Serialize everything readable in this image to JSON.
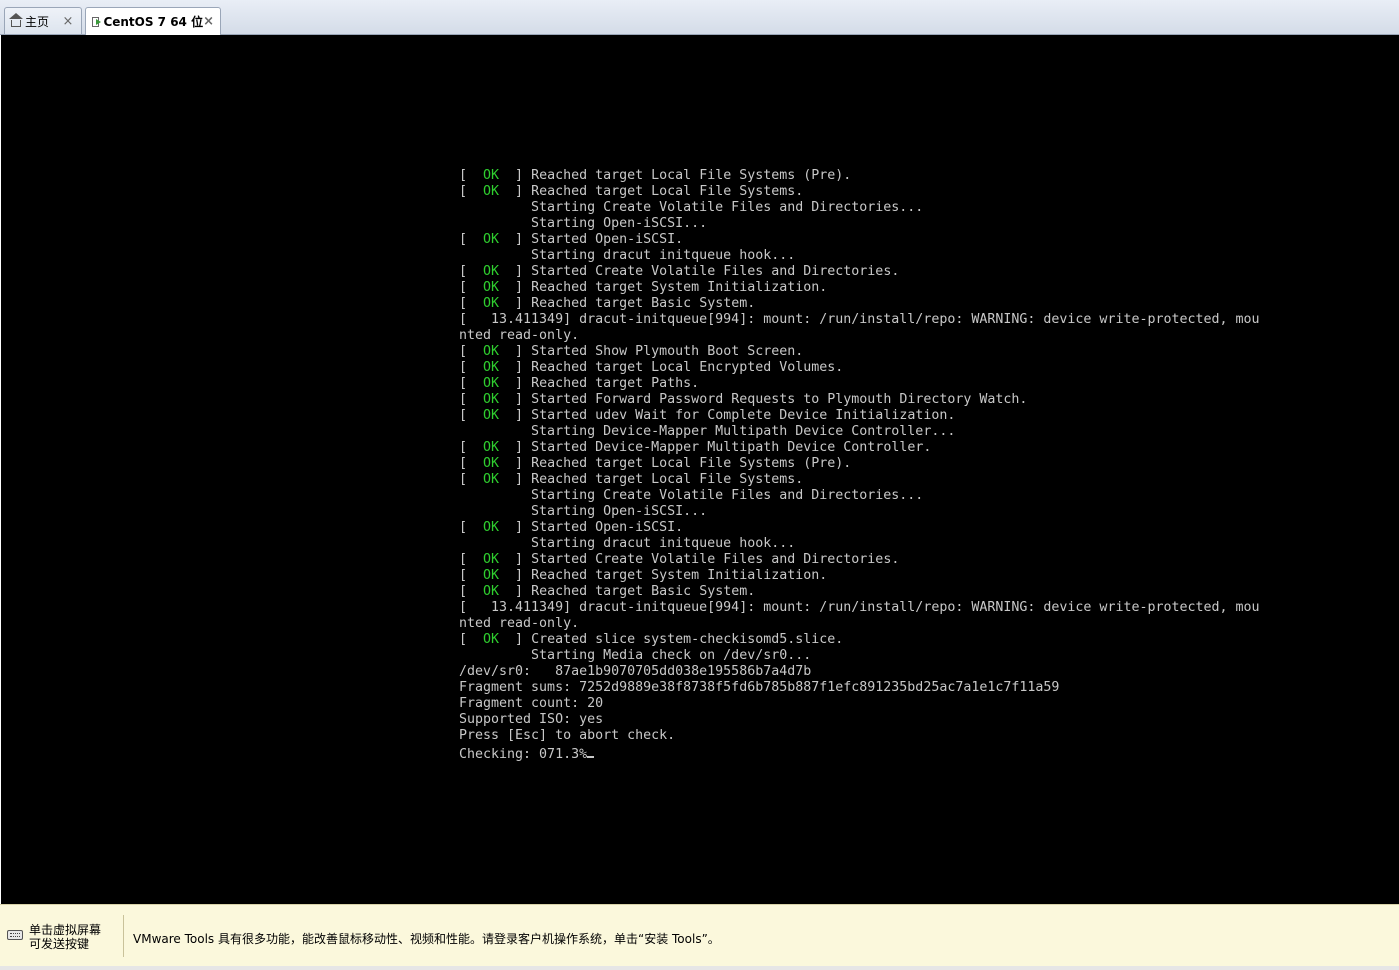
{
  "tabs": [
    {
      "label": "主页",
      "icon": "home-icon",
      "close": "×"
    },
    {
      "label": "CentOS 7 64 位",
      "icon": "vm-icon",
      "close": "×"
    }
  ],
  "console_lines": [
    {
      "ok": true,
      "text": "Reached target Local File Systems (Pre)."
    },
    {
      "ok": true,
      "text": "Reached target Local File Systems."
    },
    {
      "ok": false,
      "text": "         Starting Create Volatile Files and Directories..."
    },
    {
      "ok": false,
      "text": "         Starting Open-iSCSI..."
    },
    {
      "ok": true,
      "text": "Started Open-iSCSI."
    },
    {
      "ok": false,
      "text": "         Starting dracut initqueue hook..."
    },
    {
      "ok": true,
      "text": "Started Create Volatile Files and Directories."
    },
    {
      "ok": true,
      "text": "Reached target System Initialization."
    },
    {
      "ok": true,
      "text": "Reached target Basic System."
    },
    {
      "ok": false,
      "text": "[   13.411349] dracut-initqueue[994]: mount: /run/install/repo: WARNING: device write-protected, mou"
    },
    {
      "ok": false,
      "text": "nted read-only."
    },
    {
      "ok": true,
      "text": "Started Show Plymouth Boot Screen."
    },
    {
      "ok": true,
      "text": "Reached target Local Encrypted Volumes."
    },
    {
      "ok": true,
      "text": "Reached target Paths."
    },
    {
      "ok": true,
      "text": "Started Forward Password Requests to Plymouth Directory Watch."
    },
    {
      "ok": true,
      "text": "Started udev Wait for Complete Device Initialization."
    },
    {
      "ok": false,
      "text": "         Starting Device-Mapper Multipath Device Controller..."
    },
    {
      "ok": true,
      "text": "Started Device-Mapper Multipath Device Controller."
    },
    {
      "ok": true,
      "text": "Reached target Local File Systems (Pre)."
    },
    {
      "ok": true,
      "text": "Reached target Local File Systems."
    },
    {
      "ok": false,
      "text": "         Starting Create Volatile Files and Directories..."
    },
    {
      "ok": false,
      "text": "         Starting Open-iSCSI..."
    },
    {
      "ok": true,
      "text": "Started Open-iSCSI."
    },
    {
      "ok": false,
      "text": "         Starting dracut initqueue hook..."
    },
    {
      "ok": true,
      "text": "Started Create Volatile Files and Directories."
    },
    {
      "ok": true,
      "text": "Reached target System Initialization."
    },
    {
      "ok": true,
      "text": "Reached target Basic System."
    },
    {
      "ok": false,
      "text": "[   13.411349] dracut-initqueue[994]: mount: /run/install/repo: WARNING: device write-protected, mou"
    },
    {
      "ok": false,
      "text": "nted read-only."
    },
    {
      "ok": true,
      "text": "Created slice system-checkisomd5.slice."
    },
    {
      "ok": false,
      "text": "         Starting Media check on /dev/sr0..."
    },
    {
      "ok": false,
      "text": "/dev/sr0:   87ae1b9070705dd038e195586b7a4d7b"
    },
    {
      "ok": false,
      "text": "Fragment sums: 7252d9889e38f8738f5fd6b785b887f1efc891235bd25ac7a1e1c7f11a59"
    },
    {
      "ok": false,
      "text": "Fragment count: 20"
    },
    {
      "ok": false,
      "text": "Supported ISO: yes"
    },
    {
      "ok": false,
      "text": "Press [Esc] to abort check."
    },
    {
      "ok": false,
      "text": "Checking: 071.3%",
      "cursor": true
    }
  ],
  "ok_label": "OK",
  "notice": {
    "left_line1": "单击虚拟屏幕",
    "left_line2": "可发送按键",
    "message": "VMware Tools 具有很多功能，能改善鼠标移动性、视频和性能。请登录客户机操作系统，单击“安装 Tools”。"
  },
  "colors": {
    "console_bg": "#000000",
    "console_text": "#c8c8c8",
    "ok_green": "#2fcf2f",
    "notice_bg": "#fbf8dc"
  }
}
